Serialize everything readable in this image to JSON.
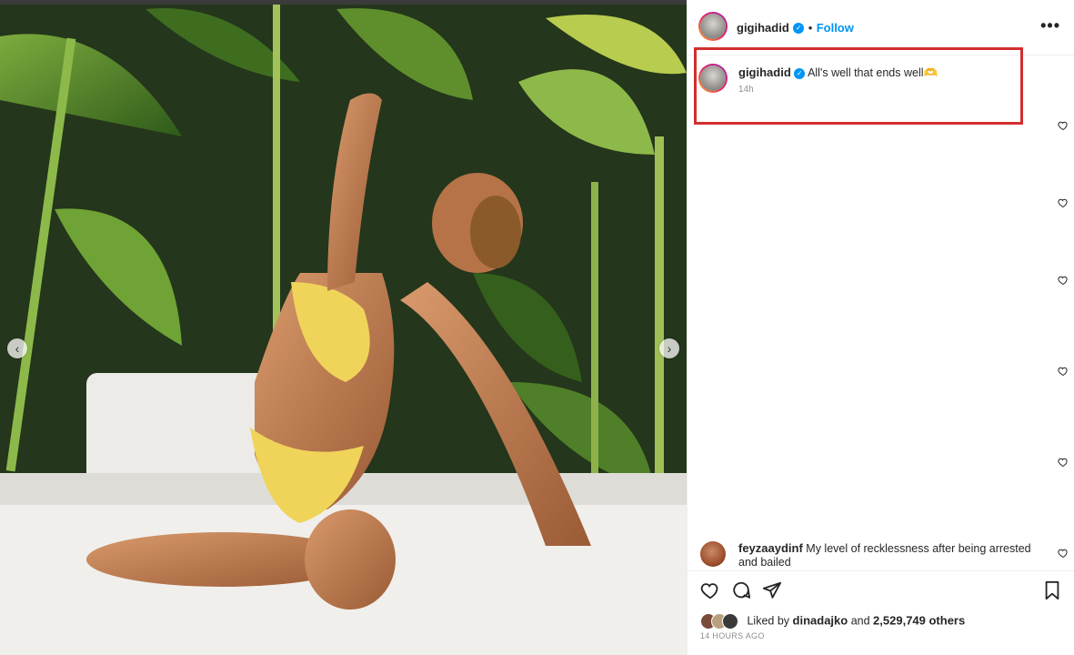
{
  "post": {
    "photo_alt": "",
    "author": "gigihadid",
    "follow_label": "Follow",
    "more_label": "•••"
  },
  "caption": {
    "author": "gigihadid",
    "text": "All's well that ends well🫶",
    "age": "14h"
  },
  "comments": [
    {
      "author": "feyzaaydinf",
      "text": "My level of recklessness after being arrested and bailed"
    }
  ],
  "likes": {
    "prefix": "Liked by",
    "user": "dinadajko",
    "connector": "and",
    "count": "2,529,749 others"
  },
  "timestamp": "14 HOURS AGO",
  "icons": {
    "verified": "verified-badge-icon",
    "like": "heart-icon",
    "comment": "comment-icon",
    "share": "share-icon",
    "save": "bookmark-icon",
    "prev": "chevron-left-icon",
    "next": "chevron-right-icon"
  },
  "colors": {
    "accent": "#0095f6",
    "highlight": "#d32f2f",
    "text": "#262626",
    "muted": "#8e8e8e"
  }
}
